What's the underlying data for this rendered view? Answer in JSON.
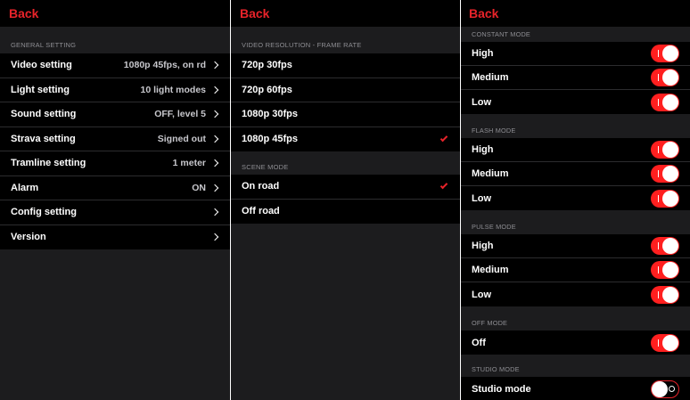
{
  "colors": {
    "accent": "#e8232a",
    "background": "#1c1c1e",
    "row": "#000000",
    "section_text": "#8e8e93"
  },
  "panel1": {
    "back": "Back",
    "section": "GENERAL SETTING",
    "rows": [
      {
        "label": "Video setting",
        "value": "1080p 45fps, on rd"
      },
      {
        "label": "Light setting",
        "value": "10 light modes"
      },
      {
        "label": "Sound setting",
        "value": "OFF, level 5"
      },
      {
        "label": "Strava setting",
        "value": "Signed out"
      },
      {
        "label": "Tramline setting",
        "value": "1 meter"
      },
      {
        "label": "Alarm",
        "value": "ON"
      },
      {
        "label": "Config setting",
        "value": ""
      },
      {
        "label": "Version",
        "value": ""
      }
    ]
  },
  "panel2": {
    "back": "Back",
    "section_video": "VIDEO RESOLUTION - FRAME RATE",
    "video_options": [
      {
        "label": "720p 30fps",
        "selected": false
      },
      {
        "label": "720p 60fps",
        "selected": false
      },
      {
        "label": "1080p 30fps",
        "selected": false
      },
      {
        "label": "1080p 45fps",
        "selected": true
      }
    ],
    "section_scene": "SCENE MODE",
    "scene_options": [
      {
        "label": "On road",
        "selected": true
      },
      {
        "label": "Off road",
        "selected": false
      }
    ]
  },
  "panel3": {
    "back": "Back",
    "constant": {
      "title": "CONSTANT MODE",
      "items": [
        "High",
        "Medium",
        "Low"
      ],
      "on": [
        true,
        true,
        true
      ]
    },
    "flash": {
      "title": "FLASH MODE",
      "items": [
        "High",
        "Medium",
        "Low"
      ],
      "on": [
        true,
        true,
        true
      ]
    },
    "pulse": {
      "title": "PULSE MODE",
      "items": [
        "High",
        "Medium",
        "Low"
      ],
      "on": [
        true,
        true,
        true
      ]
    },
    "offmode": {
      "title": "OFF MODE",
      "items": [
        "Off"
      ],
      "on": [
        true
      ]
    },
    "studio": {
      "title": "STUDIO MODE",
      "items": [
        "Studio mode"
      ],
      "on": [
        false
      ]
    }
  }
}
